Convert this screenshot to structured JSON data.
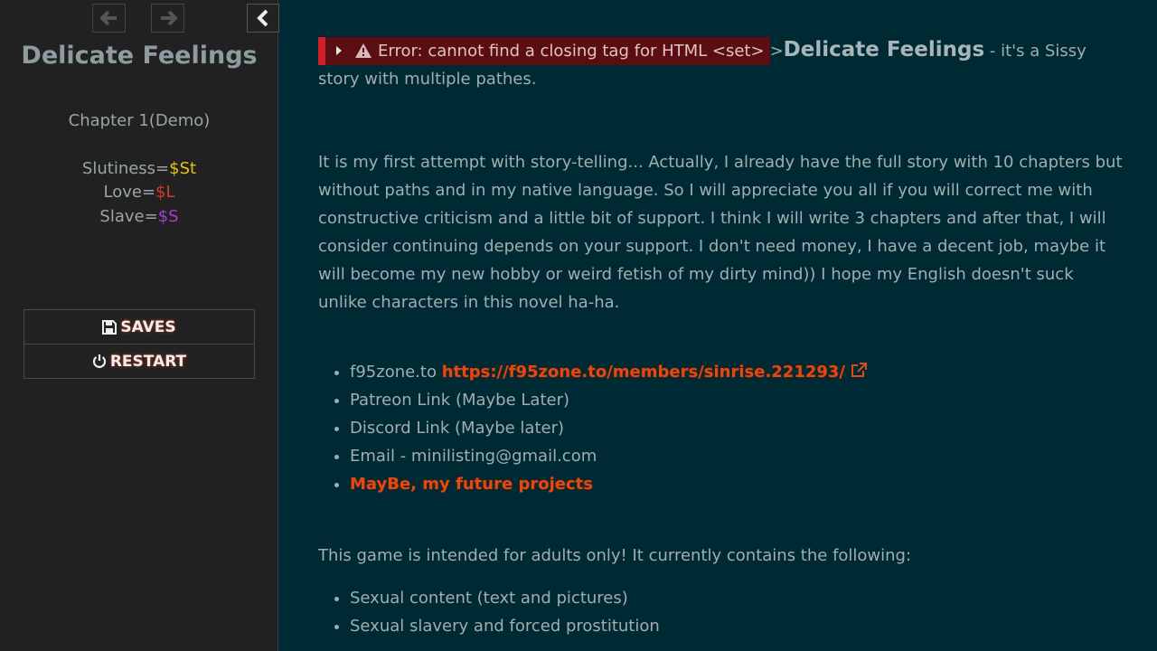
{
  "sidebar": {
    "title": "Delicate Feelings",
    "chapter": "Chapter 1(Demo)",
    "stats": [
      {
        "label": "Slutiness=",
        "value": "$St"
      },
      {
        "label": "Love=",
        "value": "$L"
      },
      {
        "label": "Slave=",
        "value": "$S"
      }
    ],
    "saves_label": "SAVES",
    "restart_label": "RESTART"
  },
  "passage": {
    "error_text": "Error: cannot find a closing tag for HTML <set>",
    "after_error": ">",
    "story_name": "Delicate Feelings",
    "intro_tail": " - it's a Sissy story with multiple pathes.",
    "paragraph": "It is my first attempt with story-telling... Actually, I already have the full story with 10 chapters but without paths and in my native language. So I will appreciate you all if you will correct me with constructive criticism and a little bit of support. I think I will write 3 chapters and after that, I will consider continuing depends on your support. I don't need money, I have a decent job, maybe it will become my new hobby or weird fetish of my dirty mind)) I hope my English doesn't suck unlike characters in this novel ha-ha.",
    "links": {
      "f95_prefix": "f95zone.to ",
      "f95_url": "https://f95zone.to/members/sinrise.221293/",
      "patreon": "Patreon Link (Maybe Later)",
      "discord": "Discord Link (Maybe later)",
      "email": "Email - minilisting@gmail.com",
      "projects": "MayBe, my future projects"
    },
    "adults_notice": "This game is intended for adults only! It currently contains the following:",
    "content_list": [
      "Sexual content (text and pictures)",
      "Sexual slavery and forced prostitution"
    ]
  },
  "colors": {
    "background": "#002a33",
    "sidebar": "#212121",
    "link": "#e04a14",
    "error": "#5a0d12"
  },
  "icons": [
    "arrow-left-icon",
    "arrow-right-icon",
    "chevron-left-icon",
    "save-icon",
    "power-icon",
    "caret-right-icon",
    "warning-icon",
    "external-link-icon"
  ]
}
